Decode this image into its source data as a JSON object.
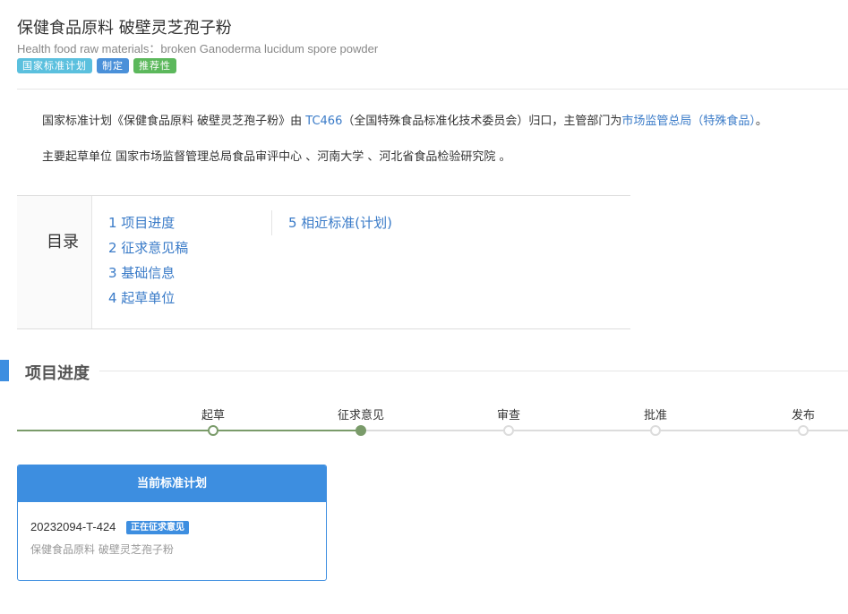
{
  "header": {
    "title": "保健食品原料 破壁灵芝孢子粉",
    "subtitle": "Health food raw materials：broken Ganoderma lucidum spore powder",
    "tags": [
      {
        "label": "国家标准计划",
        "color": "#5bc0de"
      },
      {
        "label": "制定",
        "color": "#4a90d9"
      },
      {
        "label": "推荐性",
        "color": "#5cb85c"
      }
    ]
  },
  "description": {
    "line1_prefix": "国家标准计划《保健食品原料 破壁灵芝孢子粉》由 ",
    "tc_link": "TC466",
    "line1_mid": "（全国特殊食品标准化技术委员会）归口，主管部门为",
    "dept_link": "市场监管总局（特殊食品）",
    "line1_suffix": "。",
    "line2": "主要起草单位 国家市场监督管理总局食品审评中心 、河南大学 、河北省食品检验研究院 。"
  },
  "toc": {
    "label": "目录",
    "items": [
      "1  项目进度",
      "2  征求意见稿",
      "3  基础信息",
      "4  起草单位",
      "5  相近标准(计划)"
    ]
  },
  "progress": {
    "section_title": "项目进度",
    "current_index": 1,
    "steps": [
      {
        "label": "起草",
        "state": "done"
      },
      {
        "label": "征求意见",
        "state": "current"
      },
      {
        "label": "审查",
        "state": "pending"
      },
      {
        "label": "批准",
        "state": "pending"
      },
      {
        "label": "发布",
        "state": "pending"
      }
    ],
    "colors": {
      "done": "#7a9b6a",
      "pending": "#dcdcdc"
    }
  },
  "card": {
    "header": "当前标准计划",
    "code": "20232094-T-424",
    "badge": "正在征求意见",
    "name": "保健食品原料 破壁灵芝孢子粉",
    "accent": "#3d8ee0"
  }
}
